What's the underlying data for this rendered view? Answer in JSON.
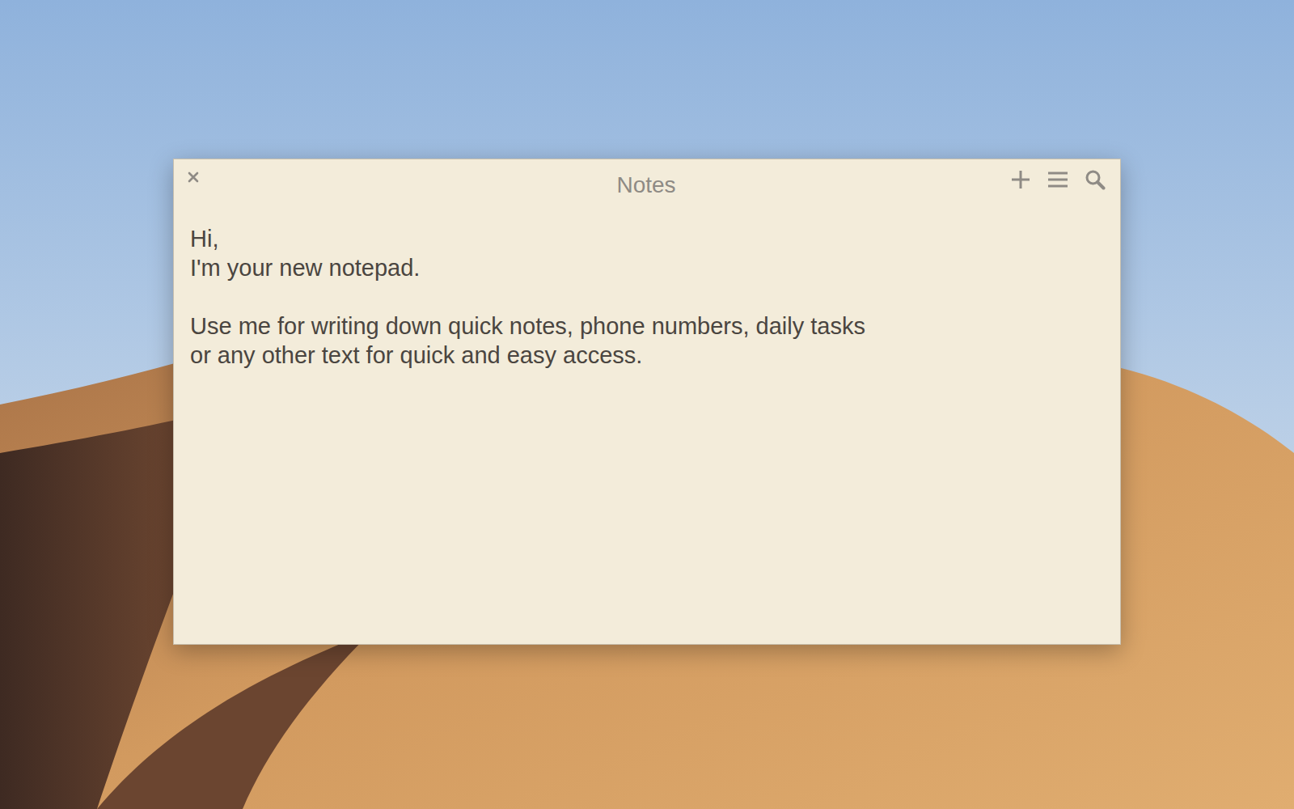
{
  "window": {
    "title": "Notes"
  },
  "note": {
    "paragraphs": [
      [
        "Hi,",
        "I'm your new notepad."
      ],
      [
        "Use me for writing down quick notes, phone numbers, daily tasks",
        "or any other text for quick and easy access."
      ]
    ]
  }
}
